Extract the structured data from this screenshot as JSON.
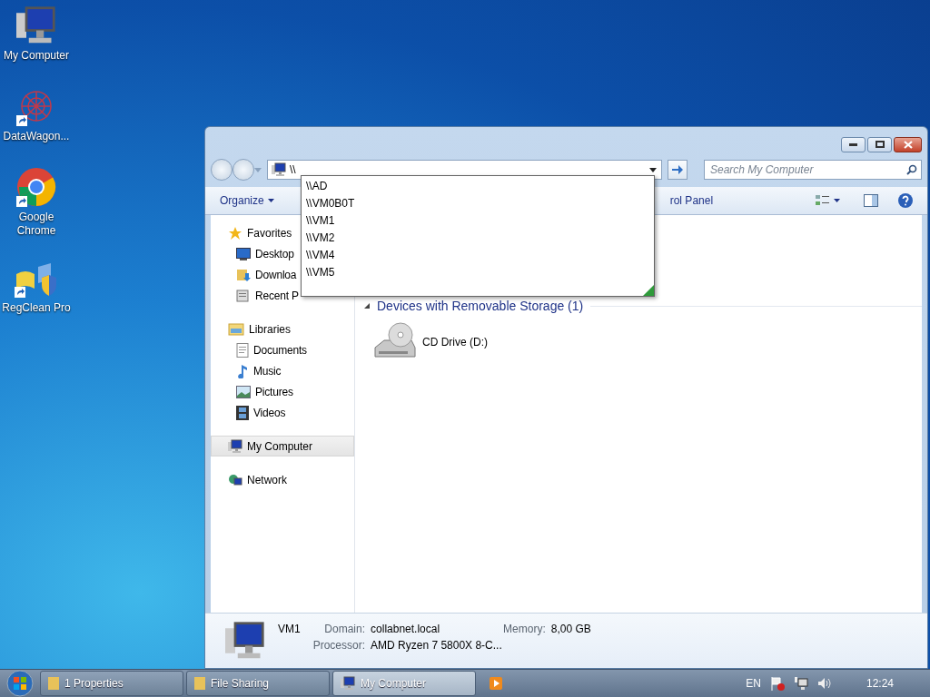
{
  "desktop_icons": [
    {
      "label": "My Computer",
      "kind": "computer"
    },
    {
      "label": "DataWagon...",
      "kind": "datawagon"
    },
    {
      "label": "Google Chrome",
      "kind": "chrome"
    },
    {
      "label": "RegClean Pro",
      "kind": "regclean"
    }
  ],
  "window": {
    "address": {
      "value": "\\\\",
      "suggestions": [
        "\\\\AD",
        "\\\\VM0B0T",
        "\\\\VM1",
        "\\\\VM2",
        "\\\\VM4",
        "\\\\VM5"
      ]
    },
    "search": {
      "placeholder": "Search My Computer"
    },
    "toolbar": {
      "organize": "Organize",
      "partial_item": "rol Panel"
    },
    "sidebar": [
      {
        "label": "Favorites",
        "kind": "star",
        "selected": false,
        "children": [
          {
            "label": "Desktop",
            "kind": "desktop",
            "selected": false
          },
          {
            "label": "Downloa",
            "kind": "download",
            "selected": false
          },
          {
            "label": "Recent P",
            "kind": "recent",
            "selected": false
          }
        ]
      },
      {
        "label": "Libraries",
        "kind": "library",
        "selected": false,
        "children": [
          {
            "label": "Documents",
            "kind": "document",
            "selected": false
          },
          {
            "label": "Music",
            "kind": "music",
            "selected": false
          },
          {
            "label": "Pictures",
            "kind": "picture",
            "selected": false
          },
          {
            "label": "Videos",
            "kind": "video",
            "selected": false
          }
        ]
      },
      {
        "label": "My Computer",
        "kind": "computer",
        "selected": true
      },
      {
        "label": "Network",
        "kind": "network",
        "selected": false
      }
    ],
    "content": [
      {
        "title": "Devices with Removable Storage (1)",
        "items": [
          {
            "label": "CD Drive (D:)"
          }
        ]
      }
    ],
    "details": {
      "name": "VM1",
      "fields": [
        {
          "label": "Domain:",
          "value": "collabnet.local"
        },
        {
          "label": "Memory:",
          "value": "8,00 GB"
        },
        {
          "label": "Processor:",
          "value": "AMD Ryzen 7 5800X 8-C..."
        }
      ]
    }
  },
  "taskbar": {
    "tasks": [
      {
        "label": "1 Properties",
        "kind": "folder",
        "selected": false
      },
      {
        "label": "File Sharing",
        "kind": "folder",
        "selected": false
      },
      {
        "label": "My Computer",
        "kind": "computer",
        "selected": true
      }
    ],
    "language": "EN",
    "time": "12:24"
  }
}
